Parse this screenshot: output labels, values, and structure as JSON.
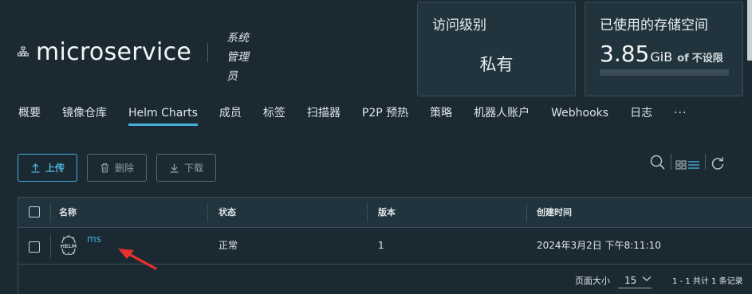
{
  "header": {
    "project_name": "microservice",
    "role": "系统管理员"
  },
  "cards": {
    "access": {
      "title": "访问级别",
      "value": "私有"
    },
    "storage": {
      "title": "已使用的存储空间",
      "used": "3.85",
      "unit": "GiB",
      "of": "of",
      "limit": "不设限",
      "usage_fraction": 0.0
    }
  },
  "tabs": [
    {
      "label": "概要"
    },
    {
      "label": "镜像仓库"
    },
    {
      "label": "Helm Charts",
      "active": true
    },
    {
      "label": "成员"
    },
    {
      "label": "标签"
    },
    {
      "label": "扫描器"
    },
    {
      "label": "P2P 预热"
    },
    {
      "label": "策略"
    },
    {
      "label": "机器人账户"
    },
    {
      "label": "Webhooks"
    },
    {
      "label": "日志"
    },
    {
      "label": "···"
    }
  ],
  "toolbar": {
    "upload_label": "上传",
    "delete_label": "删除",
    "download_label": "下载"
  },
  "table": {
    "columns": [
      "名称",
      "状态",
      "版本",
      "创建时间"
    ],
    "rows": [
      {
        "name": "ms",
        "status": "正常",
        "version": "1",
        "created": "2024年3月2日 下午8:11:10",
        "icon": "helm-icon"
      }
    ]
  },
  "pagination": {
    "page_size_label": "页面大小",
    "page_size": "15",
    "count_text": "1 - 1 共计 1 条记录"
  },
  "colors": {
    "background": "#1b2a32",
    "accent": "#49afd9",
    "annotation_arrow": "#e8302f"
  }
}
